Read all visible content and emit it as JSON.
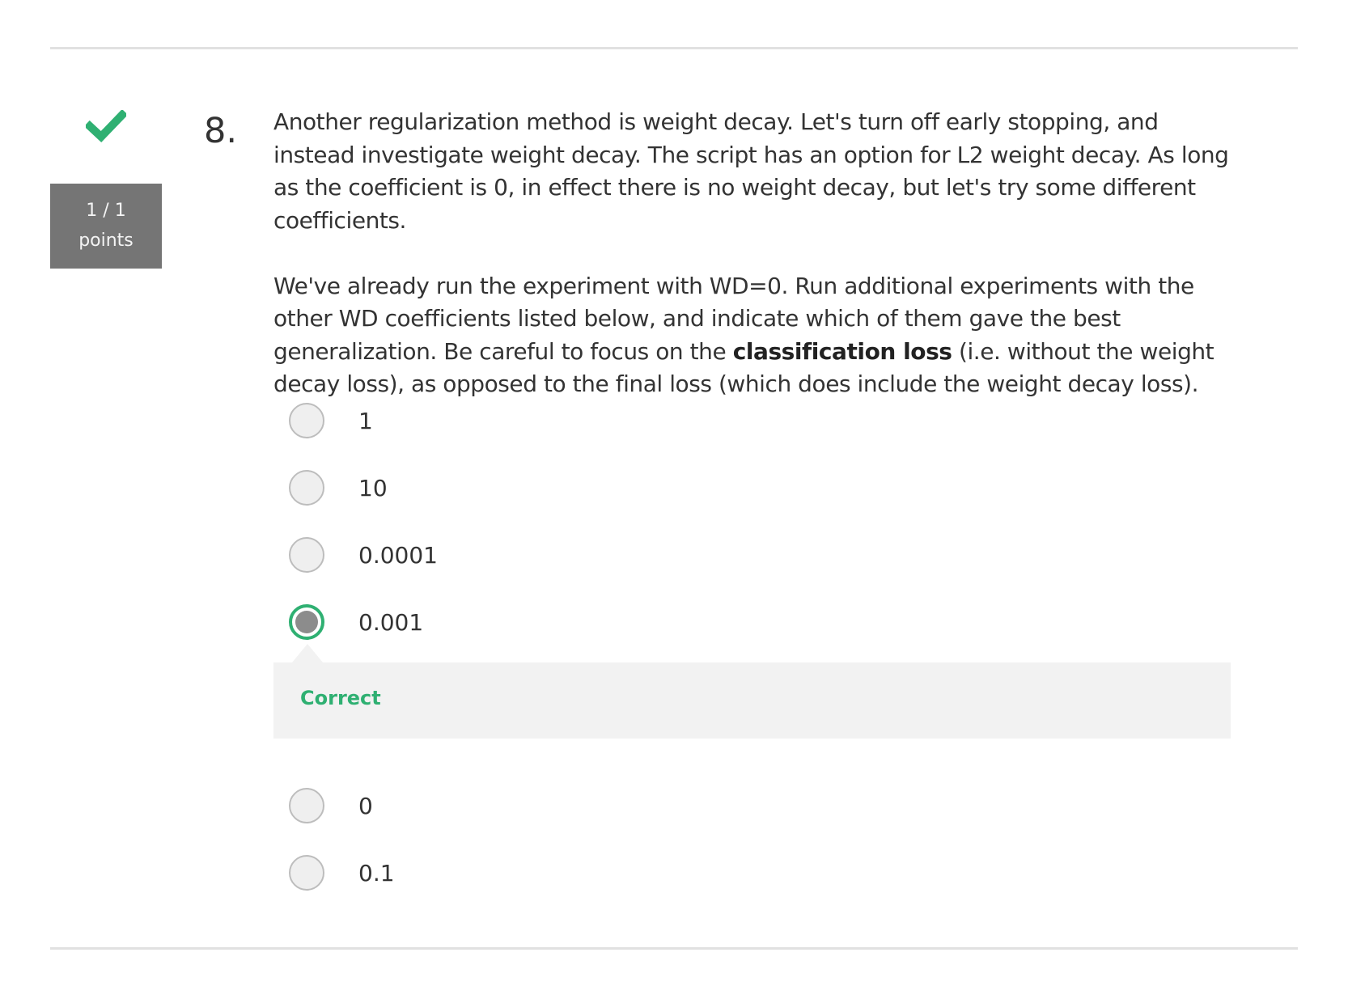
{
  "status": {
    "icon": "check-icon",
    "color": "#2fb072"
  },
  "points": {
    "score": "1 / 1",
    "label": "points"
  },
  "question": {
    "number": "8.",
    "paragraph1": "Another regularization method is weight decay. Let's turn off early stopping, and instead investigate weight decay. The script has an option for L2 weight decay. As long as the coefficient is 0, in effect there is no weight decay, but let's try some different coefficients.",
    "paragraph2_before": "We've already run the experiment with WD=0. Run additional experiments with the other WD coefficients listed below, and indicate which of them gave the best generalization. Be careful to focus on the ",
    "paragraph2_bold": "classification loss",
    "paragraph2_after": " (i.e. without the weight decay loss), as opposed to the final loss (which does include the weight decay loss)."
  },
  "options": [
    {
      "label": "1",
      "selected": false
    },
    {
      "label": "10",
      "selected": false
    },
    {
      "label": "0.0001",
      "selected": false
    },
    {
      "label": "0.001",
      "selected": true
    },
    {
      "label": "0",
      "selected": false
    },
    {
      "label": "0.1",
      "selected": false
    }
  ],
  "feedback": {
    "text": "Correct",
    "color": "#2fb072"
  }
}
